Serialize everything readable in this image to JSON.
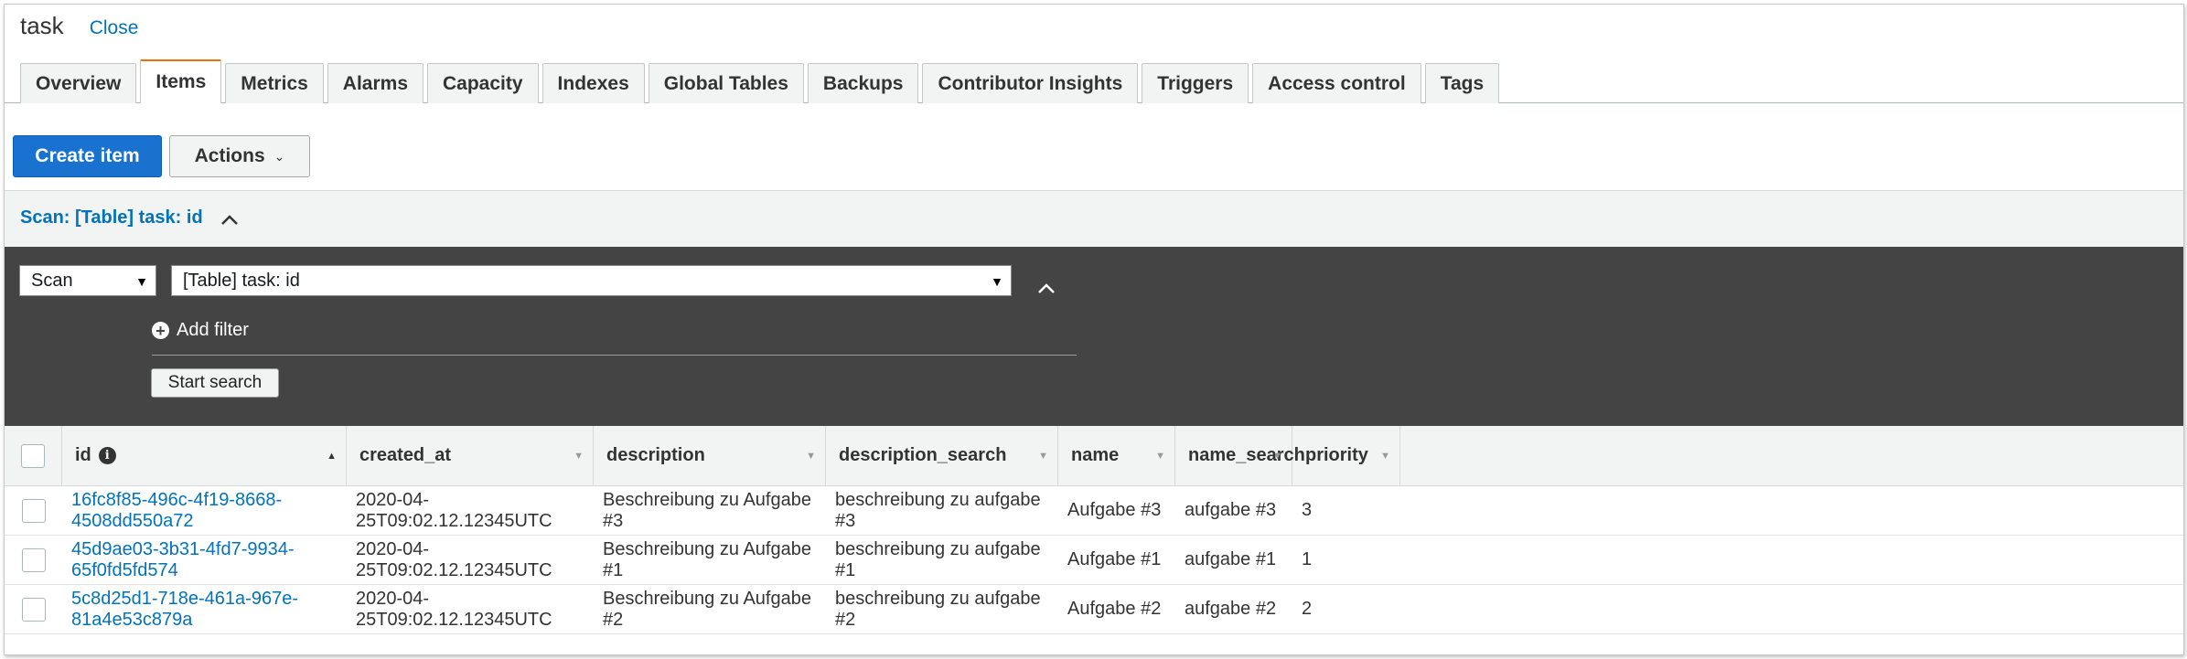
{
  "title": "task",
  "close_label": "Close",
  "tabs": [
    {
      "label": "Overview"
    },
    {
      "label": "Items",
      "active": true
    },
    {
      "label": "Metrics"
    },
    {
      "label": "Alarms"
    },
    {
      "label": "Capacity"
    },
    {
      "label": "Indexes"
    },
    {
      "label": "Global Tables"
    },
    {
      "label": "Backups"
    },
    {
      "label": "Contributor Insights"
    },
    {
      "label": "Triggers"
    },
    {
      "label": "Access control"
    },
    {
      "label": "Tags"
    }
  ],
  "toolbar": {
    "create_label": "Create item",
    "actions_label": "Actions"
  },
  "scan_header": "Scan: [Table] task: id",
  "query": {
    "mode": "Scan",
    "target": "[Table] task: id",
    "add_filter_label": "Add filter",
    "start_search_label": "Start search"
  },
  "table": {
    "columns": [
      "id",
      "created_at",
      "description",
      "description_search",
      "name",
      "name_search",
      "priority"
    ],
    "rows": [
      {
        "id": "16fc8f85-496c-4f19-8668-4508dd550a72",
        "created_at": "2020-04-25T09:02.12.12345UTC",
        "description": "Beschreibung zu Aufgabe #3",
        "description_search": "beschreibung zu aufgabe #3",
        "name": "Aufgabe #3",
        "name_search": "aufgabe #3",
        "priority": "3"
      },
      {
        "id": "45d9ae03-3b31-4fd7-9934-65f0fd5fd574",
        "created_at": "2020-04-25T09:02.12.12345UTC",
        "description": "Beschreibung zu Aufgabe #1",
        "description_search": "beschreibung zu aufgabe #1",
        "name": "Aufgabe #1",
        "name_search": "aufgabe #1",
        "priority": "1"
      },
      {
        "id": "5c8d25d1-718e-461a-967e-81a4e53c879a",
        "created_at": "2020-04-25T09:02.12.12345UTC",
        "description": "Beschreibung zu Aufgabe #2",
        "description_search": "beschreibung zu aufgabe #2",
        "name": "Aufgabe #2",
        "name_search": "aufgabe #2",
        "priority": "2"
      }
    ]
  },
  "colors": {
    "accent_tab": "#ec7211",
    "primary_button": "#1a72d0",
    "link": "#0073bb",
    "query_panel": "#444444"
  },
  "icons": {
    "scan_collapse": "chevron-up-icon",
    "panel_collapse": "chevron-up-icon",
    "add_filter": "plus-circle-icon",
    "id_info": "info-icon",
    "dropdown": "caret-down-icon"
  }
}
